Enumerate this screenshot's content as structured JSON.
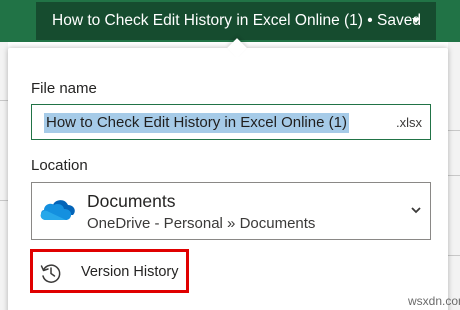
{
  "titlebar": {
    "document_title": "How to Check Edit History in Excel Online (1) • Saved",
    "dropdown_icon": "caret-down-icon"
  },
  "panel": {
    "file_name_label": "File name",
    "file_name_value": "How to Check Edit History in Excel Online (1)",
    "file_extension": ".xlsx",
    "location_label": "Location",
    "location": {
      "name": "Documents",
      "path": "OneDrive - Personal » Documents",
      "icon": "onedrive-cloud-icon",
      "chevron_icon": "chevron-down-icon"
    },
    "version_history": {
      "label": "Version History",
      "icon": "history-icon"
    }
  },
  "watermark": "wsxdn.com",
  "colors": {
    "excel_green": "#217346",
    "title_button_bg": "#164c2f",
    "selection_highlight": "#a6cbe8",
    "highlight_border": "#e00000",
    "onedrive_blue": "#0364b8"
  }
}
